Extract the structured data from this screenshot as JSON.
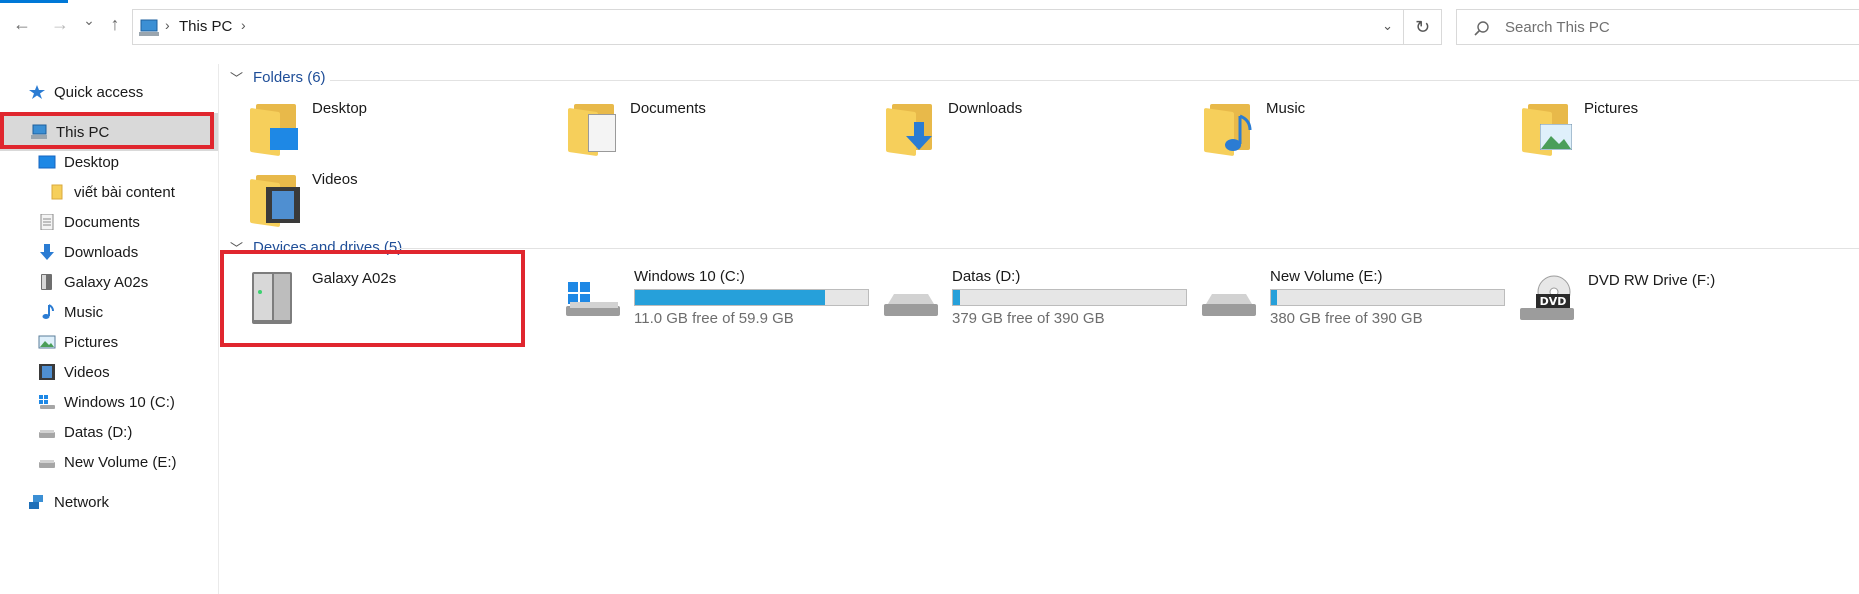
{
  "nav": {
    "back_glyph": "←",
    "forward_glyph": "→",
    "recent_glyph": "⌄",
    "up_glyph": "↑",
    "refresh_glyph": "↻",
    "dropdown_glyph": "⌄",
    "breadcrumb_sep": "›"
  },
  "address": {
    "breadcrumb": "This PC"
  },
  "search": {
    "placeholder": "Search This PC"
  },
  "sidebar": {
    "quick_access": "Quick access",
    "this_pc": "This PC",
    "items": [
      {
        "label": "Desktop",
        "icon": "desktop-icon"
      },
      {
        "label": "viết bài content",
        "icon": "folder-icon"
      },
      {
        "label": "Documents",
        "icon": "documents-icon"
      },
      {
        "label": "Downloads",
        "icon": "downloads-icon"
      },
      {
        "label": "Galaxy A02s",
        "icon": "phone-icon"
      },
      {
        "label": "Music",
        "icon": "music-icon"
      },
      {
        "label": "Pictures",
        "icon": "pictures-icon"
      },
      {
        "label": "Videos",
        "icon": "videos-icon"
      },
      {
        "label": "Windows 10 (C:)",
        "icon": "windows-drive-icon"
      },
      {
        "label": "Datas (D:)",
        "icon": "drive-icon"
      },
      {
        "label": "New Volume (E:)",
        "icon": "drive-icon"
      }
    ],
    "network": "Network"
  },
  "folders_group": {
    "heading": "Folders (6)",
    "items": [
      "Desktop",
      "Documents",
      "Downloads",
      "Music",
      "Pictures",
      "Videos"
    ]
  },
  "devices_group": {
    "heading": "Devices and drives (5)",
    "items": [
      {
        "name": "Galaxy A02s",
        "icon": "phone-device-icon"
      },
      {
        "name": "Windows 10 (C:)",
        "free_text": "11.0 GB free of 59.9 GB",
        "used_fraction": 0.816,
        "icon": "windows-drive-icon"
      },
      {
        "name": "Datas (D:)",
        "free_text": "379 GB free of 390 GB",
        "used_fraction": 0.028,
        "icon": "drive-icon"
      },
      {
        "name": "New Volume (E:)",
        "free_text": "380 GB free of 390 GB",
        "used_fraction": 0.026,
        "icon": "drive-icon"
      },
      {
        "name": "DVD RW Drive (F:)",
        "icon": "dvd-drive-icon",
        "badge": "DVD"
      }
    ]
  },
  "colors": {
    "accent": "#0078d7",
    "usage_bar": "#26a0da",
    "highlight_box": "#e0262e",
    "group_heading": "#1f4e98"
  }
}
